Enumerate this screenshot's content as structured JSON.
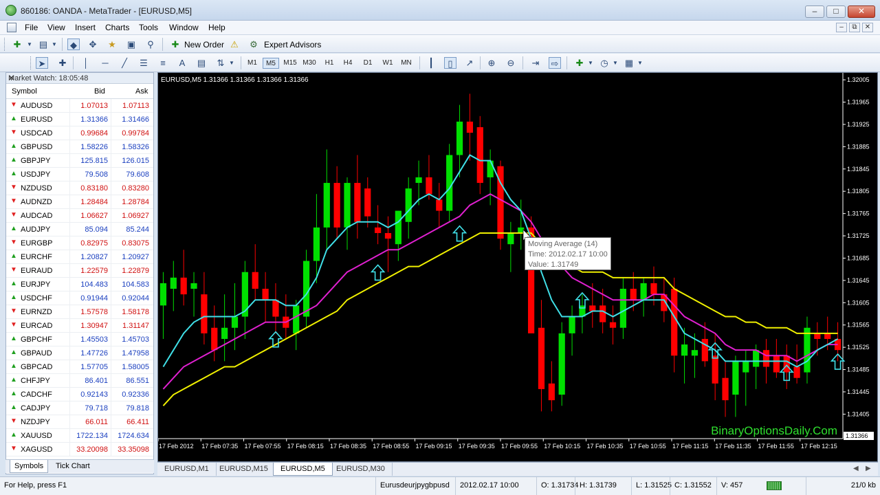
{
  "window": {
    "title": "860186: OANDA - MetaTrader - [EURUSD,M5]",
    "controls": [
      "–",
      "□",
      "✕"
    ]
  },
  "menu": {
    "items": [
      "File",
      "View",
      "Insert",
      "Charts",
      "Tools",
      "Window",
      "Help"
    ],
    "mdi_controls": [
      "–",
      "⧉",
      "✕"
    ]
  },
  "toolbar": {
    "new_order_label": "New Order",
    "expert_advisors_label": "Expert Advisors",
    "timeframes": [
      "M1",
      "M5",
      "M15",
      "M30",
      "H1",
      "H4",
      "D1",
      "W1",
      "MN"
    ],
    "active_timeframe": "M5",
    "text_tool": "A"
  },
  "market_watch": {
    "title": "Market Watch: 18:05:48",
    "close": "✕",
    "col_symbol": "Symbol",
    "col_bid": "Bid",
    "col_ask": "Ask",
    "rows": [
      {
        "symbol": "AUDUSD",
        "bid": "1.07013",
        "ask": "1.07113",
        "dir": "down"
      },
      {
        "symbol": "EURUSD",
        "bid": "1.31366",
        "ask": "1.31466",
        "dir": "up"
      },
      {
        "symbol": "USDCAD",
        "bid": "0.99684",
        "ask": "0.99784",
        "dir": "down"
      },
      {
        "symbol": "GBPUSD",
        "bid": "1.58226",
        "ask": "1.58326",
        "dir": "up"
      },
      {
        "symbol": "GBPJPY",
        "bid": "125.815",
        "ask": "126.015",
        "dir": "up"
      },
      {
        "symbol": "USDJPY",
        "bid": "79.508",
        "ask": "79.608",
        "dir": "up"
      },
      {
        "symbol": "NZDUSD",
        "bid": "0.83180",
        "ask": "0.83280",
        "dir": "down"
      },
      {
        "symbol": "AUDNZD",
        "bid": "1.28484",
        "ask": "1.28784",
        "dir": "down"
      },
      {
        "symbol": "AUDCAD",
        "bid": "1.06627",
        "ask": "1.06927",
        "dir": "down"
      },
      {
        "symbol": "AUDJPY",
        "bid": "85.094",
        "ask": "85.244",
        "dir": "up"
      },
      {
        "symbol": "EURGBP",
        "bid": "0.82975",
        "ask": "0.83075",
        "dir": "down"
      },
      {
        "symbol": "EURCHF",
        "bid": "1.20827",
        "ask": "1.20927",
        "dir": "up"
      },
      {
        "symbol": "EURAUD",
        "bid": "1.22579",
        "ask": "1.22879",
        "dir": "down"
      },
      {
        "symbol": "EURJPY",
        "bid": "104.483",
        "ask": "104.583",
        "dir": "up"
      },
      {
        "symbol": "USDCHF",
        "bid": "0.91944",
        "ask": "0.92044",
        "dir": "up"
      },
      {
        "symbol": "EURNZD",
        "bid": "1.57578",
        "ask": "1.58178",
        "dir": "down"
      },
      {
        "symbol": "EURCAD",
        "bid": "1.30947",
        "ask": "1.31147",
        "dir": "down"
      },
      {
        "symbol": "GBPCHF",
        "bid": "1.45503",
        "ask": "1.45703",
        "dir": "up"
      },
      {
        "symbol": "GBPAUD",
        "bid": "1.47726",
        "ask": "1.47958",
        "dir": "up"
      },
      {
        "symbol": "GBPCAD",
        "bid": "1.57705",
        "ask": "1.58005",
        "dir": "up"
      },
      {
        "symbol": "CHFJPY",
        "bid": "86.401",
        "ask": "86.551",
        "dir": "up"
      },
      {
        "symbol": "CADCHF",
        "bid": "0.92143",
        "ask": "0.92336",
        "dir": "up"
      },
      {
        "symbol": "CADJPY",
        "bid": "79.718",
        "ask": "79.818",
        "dir": "up"
      },
      {
        "symbol": "NZDJPY",
        "bid": "66.011",
        "ask": "66.411",
        "dir": "down"
      },
      {
        "symbol": "XAUUSD",
        "bid": "1722.134",
        "ask": "1724.634",
        "dir": "up"
      },
      {
        "symbol": "XAGUSD",
        "bid": "33.20098",
        "ask": "33.35098",
        "dir": "down"
      }
    ],
    "tabs": [
      "Symbols",
      "Tick Chart"
    ]
  },
  "chart": {
    "header": "EURUSD,M5  1.31366 1.31366 1.31366 1.31366",
    "watermark": "BinaryOptionsDaily.Com",
    "price_labels": [
      "1.32005",
      "1.31965",
      "1.31925",
      "1.31885",
      "1.31845",
      "1.31805",
      "1.31765",
      "1.31725",
      "1.31685",
      "1.31645",
      "1.31605",
      "1.31565",
      "1.31525",
      "1.31485",
      "1.31445",
      "1.31405"
    ],
    "current_price": "1.31366",
    "time_labels": [
      "17 Feb 2012",
      "17 Feb 07:35",
      "17 Feb 07:55",
      "17 Feb 08:15",
      "17 Feb 08:35",
      "17 Feb 08:55",
      "17 Feb 09:15",
      "17 Feb 09:35",
      "17 Feb 09:55",
      "17 Feb 10:15",
      "17 Feb 10:35",
      "17 Feb 10:55",
      "17 Feb 11:15",
      "17 Feb 11:35",
      "17 Feb 11:55",
      "17 Feb 12:15"
    ],
    "tooltip": {
      "line1": "Moving Average (14)",
      "line2": "Time: 2012.02.17 10:00",
      "line3": "Value: 1.31749"
    },
    "colors": {
      "bull": "#00e000",
      "bear": "#ff0000",
      "ma_fast": "#40e0e8",
      "ma_mid": "#e020d0",
      "ma_slow": "#f0f000",
      "arrow": "#40e0e8",
      "axis_text": "#ffffff"
    }
  },
  "chart_data": {
    "type": "candlestick",
    "symbol": "EURUSD",
    "timeframe": "M5",
    "ylim": [
      1.31366,
      1.32015
    ],
    "candles": [
      {
        "o": 1.316,
        "h": 1.3166,
        "l": 1.3154,
        "c": 1.3164
      },
      {
        "o": 1.3163,
        "h": 1.3168,
        "l": 1.3159,
        "c": 1.3165
      },
      {
        "o": 1.3165,
        "h": 1.317,
        "l": 1.316,
        "c": 1.3162
      },
      {
        "o": 1.3163,
        "h": 1.3166,
        "l": 1.3158,
        "c": 1.3164
      },
      {
        "o": 1.3162,
        "h": 1.3166,
        "l": 1.3153,
        "c": 1.3155
      },
      {
        "o": 1.3156,
        "h": 1.316,
        "l": 1.315,
        "c": 1.3152
      },
      {
        "o": 1.3154,
        "h": 1.3162,
        "l": 1.315,
        "c": 1.3156
      },
      {
        "o": 1.3156,
        "h": 1.3164,
        "l": 1.3152,
        "c": 1.3158
      },
      {
        "o": 1.3158,
        "h": 1.3168,
        "l": 1.3154,
        "c": 1.3166
      },
      {
        "o": 1.3166,
        "h": 1.3171,
        "l": 1.3161,
        "c": 1.3163
      },
      {
        "o": 1.3163,
        "h": 1.3166,
        "l": 1.3157,
        "c": 1.3161
      },
      {
        "o": 1.3161,
        "h": 1.3164,
        "l": 1.3155,
        "c": 1.3158
      },
      {
        "o": 1.3158,
        "h": 1.3162,
        "l": 1.3154,
        "c": 1.3156
      },
      {
        "o": 1.3155,
        "h": 1.3161,
        "l": 1.3152,
        "c": 1.316
      },
      {
        "o": 1.3158,
        "h": 1.317,
        "l": 1.3156,
        "c": 1.3168
      },
      {
        "o": 1.3168,
        "h": 1.318,
        "l": 1.3164,
        "c": 1.3174
      },
      {
        "o": 1.3174,
        "h": 1.3188,
        "l": 1.317,
        "c": 1.3182
      },
      {
        "o": 1.3182,
        "h": 1.3185,
        "l": 1.3172,
        "c": 1.3174
      },
      {
        "o": 1.3174,
        "h": 1.3183,
        "l": 1.317,
        "c": 1.3182
      },
      {
        "o": 1.3182,
        "h": 1.3187,
        "l": 1.3172,
        "c": 1.3175
      },
      {
        "o": 1.3181,
        "h": 1.3183,
        "l": 1.3174,
        "c": 1.3176
      },
      {
        "o": 1.3174,
        "h": 1.3178,
        "l": 1.3171,
        "c": 1.3173
      },
      {
        "o": 1.3173,
        "h": 1.3176,
        "l": 1.3166,
        "c": 1.3172
      },
      {
        "o": 1.3171,
        "h": 1.3177,
        "l": 1.3168,
        "c": 1.3177
      },
      {
        "o": 1.3175,
        "h": 1.3183,
        "l": 1.3172,
        "c": 1.3181
      },
      {
        "o": 1.3182,
        "h": 1.3186,
        "l": 1.3178,
        "c": 1.3183
      },
      {
        "o": 1.3183,
        "h": 1.3187,
        "l": 1.3179,
        "c": 1.318
      },
      {
        "o": 1.3179,
        "h": 1.3182,
        "l": 1.3174,
        "c": 1.3177
      },
      {
        "o": 1.3177,
        "h": 1.3189,
        "l": 1.3175,
        "c": 1.3187
      },
      {
        "o": 1.3187,
        "h": 1.3196,
        "l": 1.3183,
        "c": 1.3193
      },
      {
        "o": 1.3193,
        "h": 1.3198,
        "l": 1.3186,
        "c": 1.3191
      },
      {
        "o": 1.3192,
        "h": 1.3194,
        "l": 1.318,
        "c": 1.3182
      },
      {
        "o": 1.3183,
        "h": 1.3188,
        "l": 1.3178,
        "c": 1.3186
      },
      {
        "o": 1.3185,
        "h": 1.3186,
        "l": 1.317,
        "c": 1.3172
      },
      {
        "o": 1.3171,
        "h": 1.3175,
        "l": 1.3166,
        "c": 1.3173
      },
      {
        "o": 1.3173,
        "h": 1.3179,
        "l": 1.317,
        "c": 1.3174
      },
      {
        "o": 1.3174,
        "h": 1.3176,
        "l": 1.3164,
        "c": 1.3155
      },
      {
        "o": 1.3156,
        "h": 1.3161,
        "l": 1.3141,
        "c": 1.3145
      },
      {
        "o": 1.3146,
        "h": 1.315,
        "l": 1.3141,
        "c": 1.3143
      },
      {
        "o": 1.3144,
        "h": 1.3157,
        "l": 1.3142,
        "c": 1.3155
      },
      {
        "o": 1.3155,
        "h": 1.316,
        "l": 1.3151,
        "c": 1.3158
      },
      {
        "o": 1.3158,
        "h": 1.3162,
        "l": 1.3155,
        "c": 1.316
      },
      {
        "o": 1.316,
        "h": 1.3164,
        "l": 1.3156,
        "c": 1.3159
      },
      {
        "o": 1.316,
        "h": 1.3163,
        "l": 1.3155,
        "c": 1.3157
      },
      {
        "o": 1.3157,
        "h": 1.316,
        "l": 1.3153,
        "c": 1.3156
      },
      {
        "o": 1.3156,
        "h": 1.3165,
        "l": 1.3154,
        "c": 1.3163
      },
      {
        "o": 1.3163,
        "h": 1.3166,
        "l": 1.3159,
        "c": 1.3161
      },
      {
        "o": 1.3161,
        "h": 1.3165,
        "l": 1.3158,
        "c": 1.3164
      },
      {
        "o": 1.3164,
        "h": 1.3167,
        "l": 1.316,
        "c": 1.3162
      },
      {
        "o": 1.3162,
        "h": 1.3165,
        "l": 1.3157,
        "c": 1.3159
      },
      {
        "o": 1.3163,
        "h": 1.3165,
        "l": 1.3148,
        "c": 1.3151
      },
      {
        "o": 1.3151,
        "h": 1.3156,
        "l": 1.3146,
        "c": 1.3153
      },
      {
        "o": 1.3151,
        "h": 1.3155,
        "l": 1.3147,
        "c": 1.3152
      },
      {
        "o": 1.3154,
        "h": 1.3157,
        "l": 1.3149,
        "c": 1.315
      },
      {
        "o": 1.3151,
        "h": 1.3155,
        "l": 1.3143,
        "c": 1.3146
      },
      {
        "o": 1.3147,
        "h": 1.315,
        "l": 1.314,
        "c": 1.3143
      },
      {
        "o": 1.3144,
        "h": 1.3151,
        "l": 1.314,
        "c": 1.315
      },
      {
        "o": 1.3148,
        "h": 1.3152,
        "l": 1.3142,
        "c": 1.315
      },
      {
        "o": 1.3149,
        "h": 1.3153,
        "l": 1.3145,
        "c": 1.3152
      },
      {
        "o": 1.3152,
        "h": 1.3154,
        "l": 1.3146,
        "c": 1.3149
      },
      {
        "o": 1.3151,
        "h": 1.3154,
        "l": 1.3147,
        "c": 1.3148
      },
      {
        "o": 1.3151,
        "h": 1.3153,
        "l": 1.3145,
        "c": 1.3148
      },
      {
        "o": 1.3149,
        "h": 1.3153,
        "l": 1.3146,
        "c": 1.3147
      },
      {
        "o": 1.3148,
        "h": 1.3158,
        "l": 1.3146,
        "c": 1.3156
      },
      {
        "o": 1.3155,
        "h": 1.3157,
        "l": 1.3151,
        "c": 1.3154
      },
      {
        "o": 1.3155,
        "h": 1.3158,
        "l": 1.3152,
        "c": 1.3154
      },
      {
        "o": 1.3154,
        "h": 1.3157,
        "l": 1.315,
        "c": 1.3152
      }
    ],
    "ma_fast": [
      1.3149,
      1.3152,
      1.3155,
      1.3157,
      1.3158,
      1.3158,
      1.3158,
      1.3158,
      1.3159,
      1.3161,
      1.3161,
      1.3161,
      1.316,
      1.316,
      1.3162,
      1.3165,
      1.317,
      1.3172,
      1.3174,
      1.3175,
      1.3175,
      1.3175,
      1.3174,
      1.3175,
      1.3177,
      1.3179,
      1.318,
      1.3179,
      1.3181,
      1.3184,
      1.3187,
      1.3186,
      1.3186,
      1.3182,
      1.3179,
      1.3177,
      1.3172,
      1.3166,
      1.3161,
      1.3158,
      1.3158,
      1.3158,
      1.3159,
      1.3159,
      1.3158,
      1.3159,
      1.316,
      1.3161,
      1.3161,
      1.3161,
      1.3158,
      1.3155,
      1.3154,
      1.3153,
      1.3152,
      1.315,
      1.315,
      1.315,
      1.315,
      1.315,
      1.315,
      1.315,
      1.3149,
      1.315,
      1.3152,
      1.3153,
      1.3154
    ],
    "ma_mid": [
      1.3145,
      1.3147,
      1.3149,
      1.315,
      1.3151,
      1.3152,
      1.3153,
      1.3154,
      1.3155,
      1.3156,
      1.3157,
      1.3157,
      1.3157,
      1.3158,
      1.3159,
      1.316,
      1.3162,
      1.3164,
      1.3166,
      1.3167,
      1.3168,
      1.3169,
      1.317,
      1.317,
      1.3171,
      1.3172,
      1.3173,
      1.3174,
      1.3175,
      1.3176,
      1.3178,
      1.3179,
      1.318,
      1.3179,
      1.3178,
      1.3177,
      1.3175,
      1.3172,
      1.3169,
      1.3167,
      1.3165,
      1.3164,
      1.3163,
      1.3162,
      1.3161,
      1.3161,
      1.3161,
      1.3161,
      1.3162,
      1.3162,
      1.316,
      1.3158,
      1.3157,
      1.3156,
      1.3155,
      1.3153,
      1.3152,
      1.3152,
      1.3152,
      1.3151,
      1.3151,
      1.3151,
      1.315,
      1.3151,
      1.3152,
      1.3153,
      1.3153
    ],
    "ma_slow": [
      1.3142,
      1.3144,
      1.3145,
      1.3146,
      1.3147,
      1.3148,
      1.3149,
      1.3149,
      1.315,
      1.3151,
      1.3152,
      1.3153,
      1.3154,
      1.3155,
      1.3156,
      1.3157,
      1.3158,
      1.3159,
      1.3161,
      1.3162,
      1.3163,
      1.3164,
      1.3165,
      1.3166,
      1.3167,
      1.3167,
      1.3168,
      1.3169,
      1.317,
      1.3171,
      1.3172,
      1.3173,
      1.3173,
      1.3173,
      1.3173,
      1.3173,
      1.3173,
      1.3171,
      1.317,
      1.3168,
      1.3167,
      1.3166,
      1.3166,
      1.3166,
      1.3165,
      1.3165,
      1.3165,
      1.3165,
      1.3165,
      1.3165,
      1.3163,
      1.3162,
      1.3161,
      1.316,
      1.3159,
      1.3158,
      1.3158,
      1.3157,
      1.3157,
      1.3156,
      1.3156,
      1.3156,
      1.3155,
      1.3155,
      1.3155,
      1.3155,
      1.3155
    ],
    "signal_arrows_at": [
      11,
      21,
      29,
      41,
      54,
      61,
      66
    ]
  },
  "chart_tabs": {
    "tabs": [
      "EURUSD,M1",
      "EURUSD,M15",
      "EURUSD,M5",
      "EURUSD,M30"
    ],
    "active": "EURUSD,M5",
    "nav_left": "◀",
    "nav_right": "▶"
  },
  "status": {
    "help": "For Help, press F1",
    "profile": "Eurusdeurjpygbpusd",
    "datetime": "2012.02.17 10:00",
    "open": "O: 1.31734",
    "high": "H: 1.31739",
    "low": "L: 1.31525",
    "close": "C: 1.31552",
    "volume": "V: 457",
    "traffic": "21/0 kb"
  }
}
